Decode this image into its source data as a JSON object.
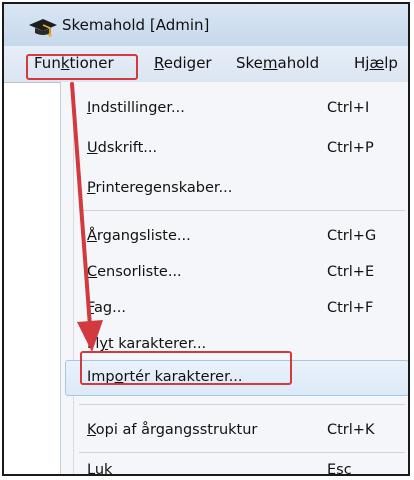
{
  "window": {
    "title": "Skemahold [Admin]",
    "app_icon": "hat-icon"
  },
  "menubar": {
    "funktioner": {
      "pre": "Fun",
      "u": "k",
      "post": "tioner"
    },
    "rediger": {
      "pre": "",
      "u": "R",
      "post": "ediger"
    },
    "skemahold": {
      "pre": "Ske",
      "u": "m",
      "post": "ahold"
    },
    "hjaelp": {
      "pre": "Hj",
      "u": "æ",
      "post": "lp"
    }
  },
  "menu": {
    "indstillinger": {
      "pre": "",
      "u": "I",
      "post": "ndstillinger...",
      "shortcut": "Ctrl+I"
    },
    "udskrift": {
      "pre": "",
      "u": "U",
      "post": "dskrift...",
      "shortcut": "Ctrl+P"
    },
    "printeregenskaber": {
      "pre": "",
      "u": "P",
      "post": "rinteregenskaber..."
    },
    "argangsliste": {
      "pre": "",
      "u": "Å",
      "post": "rgangsliste...",
      "shortcut": "Ctrl+G"
    },
    "censorliste": {
      "pre": "",
      "u": "C",
      "post": "ensorliste...",
      "shortcut": "Ctrl+E"
    },
    "fag": {
      "pre": "",
      "u": "F",
      "post": "ag...",
      "shortcut": "Ctrl+F"
    },
    "flyt": {
      "pre": "Fl",
      "u": "y",
      "post": "t karakterer..."
    },
    "importer": {
      "pre": "Imp",
      "u": "o",
      "post": "rtér karakterer..."
    },
    "kopi": {
      "pre": "",
      "u": "K",
      "post": "opi af årgangsstruktur",
      "shortcut": "Ctrl+K"
    },
    "luk": {
      "pre": "",
      "u": "L",
      "post": "uk",
      "shortcut": "Esc"
    }
  },
  "annotations": {
    "highlight_color": "#d23a40"
  }
}
